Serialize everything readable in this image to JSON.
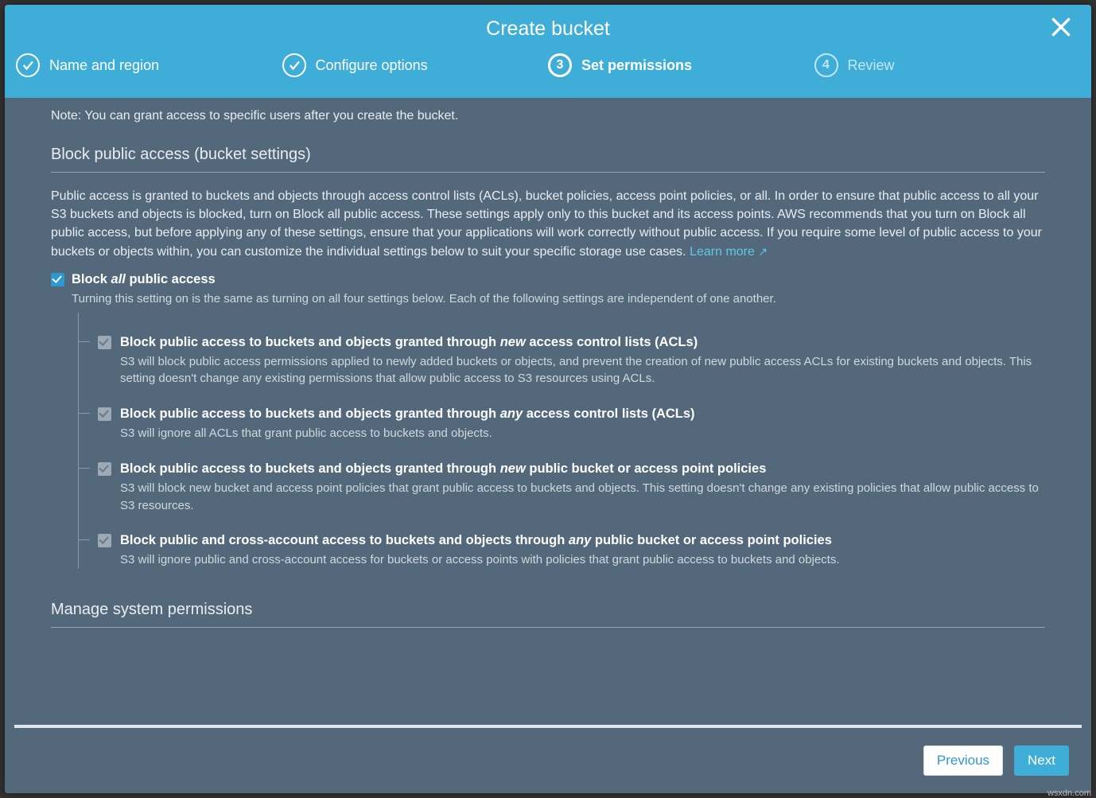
{
  "modal": {
    "title": "Create bucket"
  },
  "steps": [
    {
      "label": "Name and region",
      "state": "done"
    },
    {
      "label": "Configure options",
      "state": "done"
    },
    {
      "label": "Set permissions",
      "state": "active",
      "num": "3"
    },
    {
      "label": "Review",
      "state": "pending",
      "num": "4"
    }
  ],
  "note": "Note: You can grant access to specific users after you create the bucket.",
  "blockSection": {
    "title": "Block public access (bucket settings)",
    "desc": "Public access is granted to buckets and objects through access control lists (ACLs), bucket policies, access point policies, or all. In order to ensure that public access to all your S3 buckets and objects is blocked, turn on Block all public access. These settings apply only to this bucket and its access points. AWS recommends that you turn on Block all public access, but before applying any of these settings, ensure that your applications will work correctly without public access. If you require some level of public access to your buckets or objects within, you can customize the individual settings below to suit your specific storage use cases.",
    "learnMore": "Learn more"
  },
  "blockAll": {
    "title_pre": "Block ",
    "title_em": "all",
    "title_post": " public access",
    "sub": "Turning this setting on is the same as turning on all four settings below. Each of the following settings are independent of one another.",
    "checked": true
  },
  "childOptions": [
    {
      "title_pre": "Block public access to buckets and objects granted through ",
      "title_em": "new",
      "title_post": " access control lists (ACLs)",
      "sub": "S3 will block public access permissions applied to newly added buckets or objects, and prevent the creation of new public access ACLs for existing buckets and objects. This setting doesn't change any existing permissions that allow public access to S3 resources using ACLs."
    },
    {
      "title_pre": "Block public access to buckets and objects granted through ",
      "title_em": "any",
      "title_post": " access control lists (ACLs)",
      "sub": "S3 will ignore all ACLs that grant public access to buckets and objects."
    },
    {
      "title_pre": "Block public access to buckets and objects granted through ",
      "title_em": "new",
      "title_post": " public bucket or access point policies",
      "sub": "S3 will block new bucket and access point policies that grant public access to buckets and objects. This setting doesn't change any existing policies that allow public access to S3 resources."
    },
    {
      "title_pre": "Block public and cross-account access to buckets and objects through ",
      "title_em": "any",
      "title_post": " public bucket or access point policies",
      "sub": "S3 will ignore public and cross-account access for buckets or access points with policies that grant public access to buckets and objects."
    }
  ],
  "systemSection": {
    "title": "Manage system permissions"
  },
  "buttons": {
    "prev": "Previous",
    "next": "Next"
  },
  "watermark": "wsxdn.com"
}
